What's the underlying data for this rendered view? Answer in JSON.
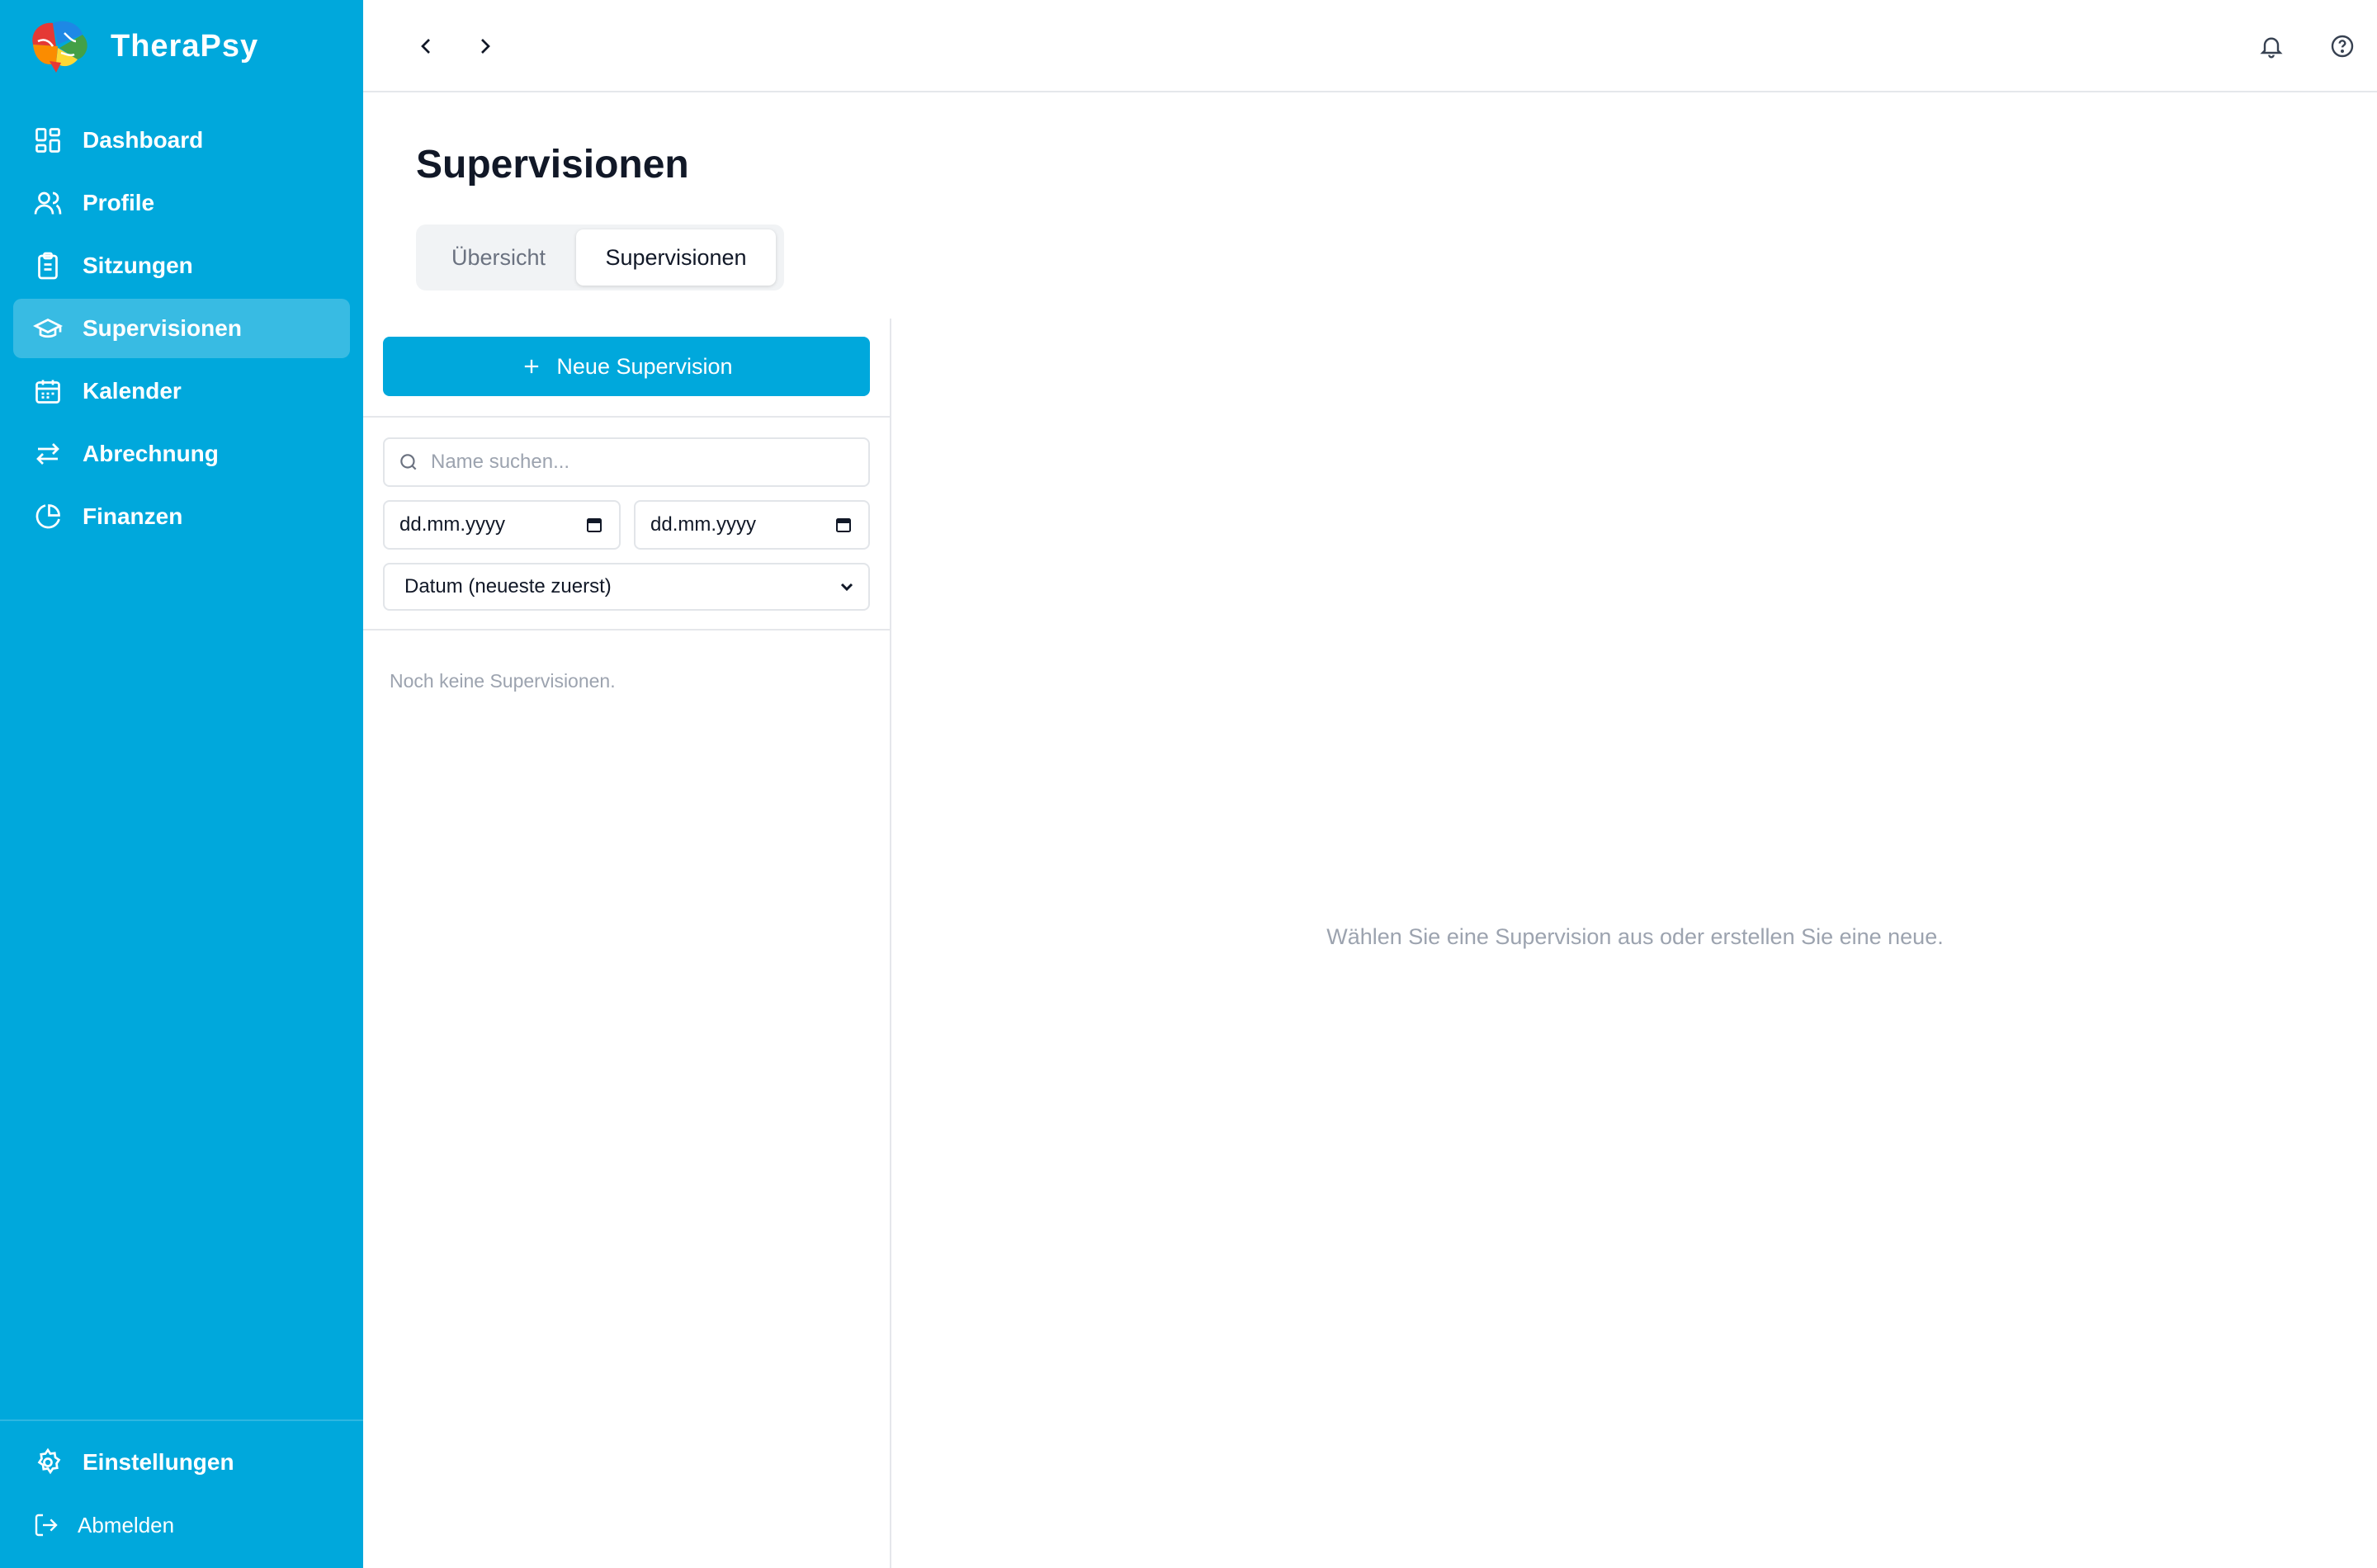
{
  "brand": {
    "name": "TheraPsy"
  },
  "sidebar": {
    "items": [
      {
        "label": "Dashboard",
        "icon": "dashboard-icon",
        "active": false
      },
      {
        "label": "Profile",
        "icon": "users-icon",
        "active": false
      },
      {
        "label": "Sitzungen",
        "icon": "clipboard-icon",
        "active": false
      },
      {
        "label": "Supervisionen",
        "icon": "graduation-cap-icon",
        "active": true
      },
      {
        "label": "Kalender",
        "icon": "calendar-icon",
        "active": false
      },
      {
        "label": "Abrechnung",
        "icon": "arrows-swap-icon",
        "active": false
      },
      {
        "label": "Finanzen",
        "icon": "pie-chart-icon",
        "active": false
      }
    ],
    "settings_label": "Einstellungen",
    "logout_label": "Abmelden"
  },
  "topbar": {
    "icons": [
      "chevron-left-icon",
      "chevron-right-icon",
      "bell-icon",
      "help-circle-icon"
    ]
  },
  "page": {
    "title": "Supervisionen",
    "tabs": [
      {
        "label": "Übersicht",
        "active": false
      },
      {
        "label": "Supervisionen",
        "active": true
      }
    ]
  },
  "list": {
    "new_button_label": "Neue Supervision",
    "search_placeholder": "Name suchen...",
    "date_from": "dd.mm.yyyy",
    "date_to": "dd.mm.yyyy",
    "sort_value": "Datum (neueste zuerst)",
    "empty_text": "Noch keine Supervisionen."
  },
  "detail": {
    "empty_text": "Wählen Sie eine Supervision aus oder erstellen Sie eine neue."
  },
  "colors": {
    "primary": "#00a8dc",
    "border": "#e5e7eb",
    "muted_text": "#9ca3af"
  }
}
